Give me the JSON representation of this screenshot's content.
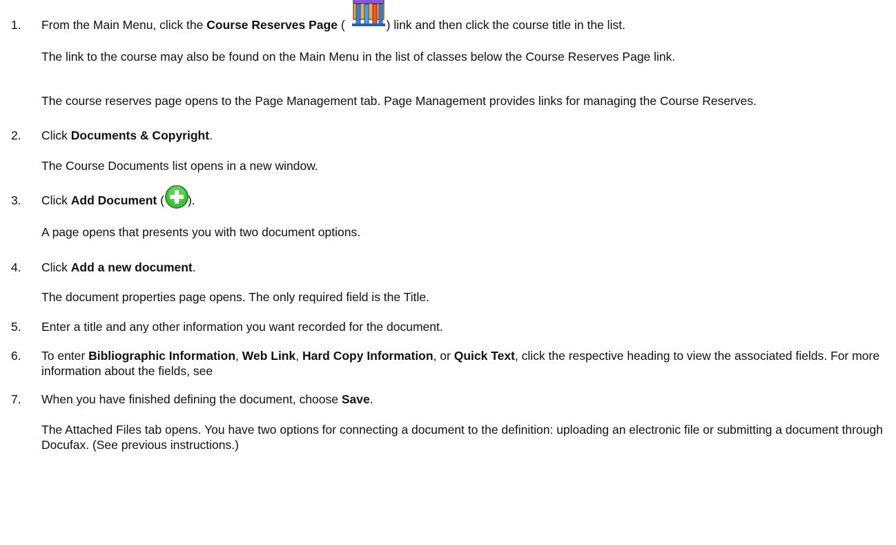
{
  "steps": [
    {
      "num": "1.",
      "parts": [
        "From the Main Menu, click the ",
        "Course Reserves Page",
        " (",
        ") link and then click the course title in the list."
      ],
      "icon": "course-reserves-icon",
      "paras": [
        "The link to the course may also be found on the Main Menu in the list of classes below the Course Reserves Page link.",
        "The course reserves page opens to the Page Management tab. Page Management provides links for managing the Course Reserves."
      ]
    },
    {
      "num": "2.",
      "parts": [
        "Click ",
        "Documents & Copyright",
        "."
      ],
      "paras": [
        "The Course Documents list opens in a new window."
      ]
    },
    {
      "num": "3.",
      "parts": [
        "Click ",
        "Add Document",
        " (",
        ")."
      ],
      "icon": "add-plus-icon",
      "paras": [
        "A page opens that presents you with two document options."
      ]
    },
    {
      "num": "4.",
      "parts": [
        "Click ",
        "Add a new document",
        "."
      ],
      "paras": [
        "The document properties page opens. The only required field is the Title."
      ]
    },
    {
      "num": "5.",
      "parts": [
        "Enter a title and any other information you want recorded for the document."
      ]
    },
    {
      "num": "6.",
      "parts": [
        "To enter ",
        "Bibliographic Information",
        ", ",
        "Web Link",
        ", ",
        "Hard Copy Information",
        ", or ",
        "Quick Text",
        ", click the respective heading to view the associated fields. For more information about the fields, see"
      ]
    },
    {
      "num": "7.",
      "parts": [
        "When you have finished defining the document, choose ",
        "Save",
        "."
      ],
      "paras": [
        "The Attached Files tab opens. You have two options for connecting a document to the definition: uploading an electronic file or submitting a document through Docufax. (See previous instructions.)"
      ]
    }
  ],
  "colors": {
    "plus_green": "#3fc23a",
    "plus_ring": "#2a8a2a"
  }
}
